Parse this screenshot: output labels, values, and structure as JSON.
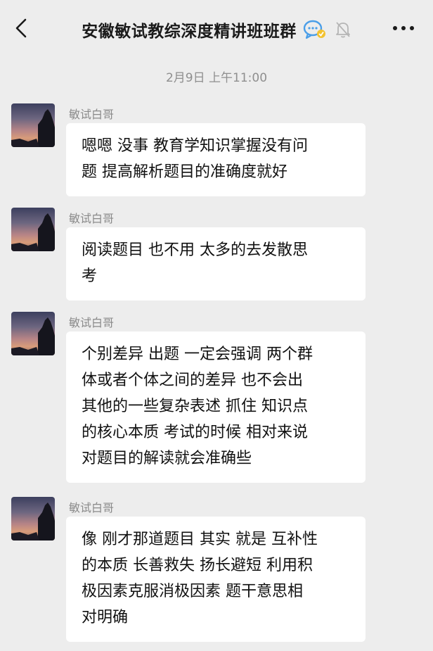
{
  "header": {
    "title": "安徽敏试教综深度精讲班班群",
    "back_icon": "chevron-left-icon",
    "more_icon": "more-dots-icon",
    "group_icon": "chat-group-icon",
    "mute_icon": "bell-muted-icon"
  },
  "timestamp": "2月9日 上午11:00",
  "messages": [
    {
      "sender": "敏试白哥",
      "text": "嗯嗯 没事 教育学知识掌握没有问\n题 提高解析题目的准确度就好"
    },
    {
      "sender": "敏试白哥",
      "text": "阅读题目 也不用 太多的去发散思\n考"
    },
    {
      "sender": "敏试白哥",
      "text": "个别差异 出题 一定会强调 两个群\n体或者个体之间的差异 也不会出\n其他的一些复杂表述 抓住 知识点\n的核心本质 考试的时候 相对来说\n对题目的解读就会准确些"
    },
    {
      "sender": "敏试白哥",
      "text": "像 刚才那道题目 其实 就是 互补性\n的本质 长善救失 扬长避短 利用积\n极因素克服消极因素 题干意思相\n对明确"
    }
  ],
  "colors": {
    "background": "#ededed",
    "bubble": "#ffffff",
    "accent_icon": "#4a9ee8"
  }
}
